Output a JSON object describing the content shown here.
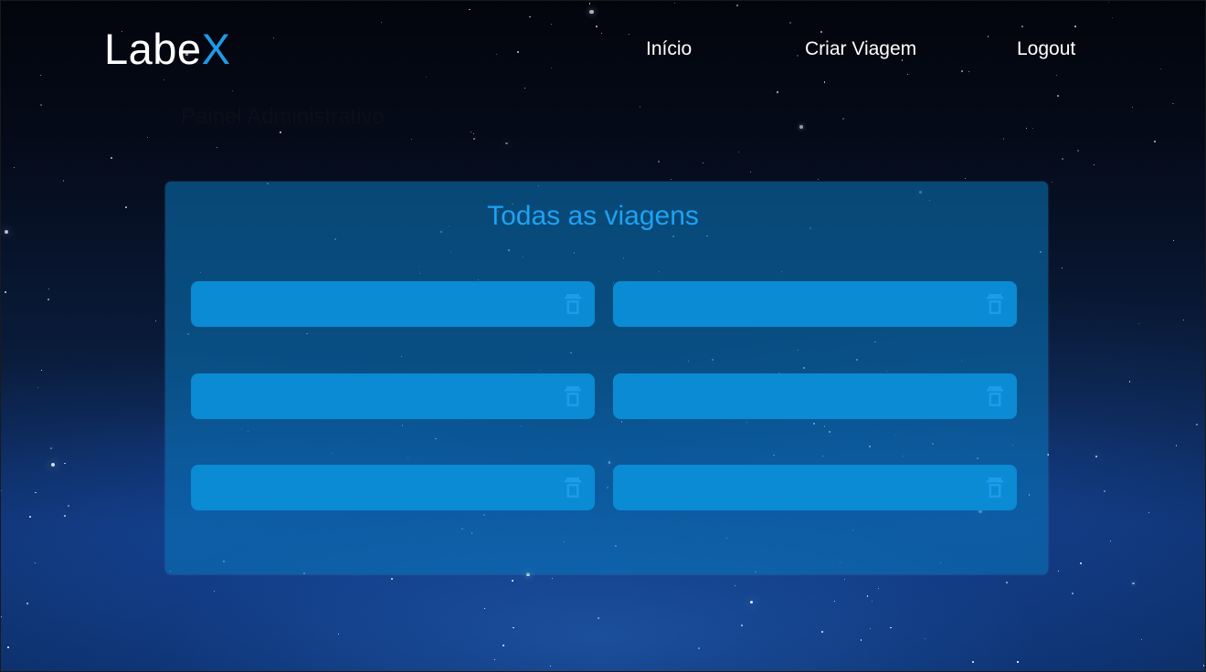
{
  "header": {
    "logo_main": "Labe",
    "logo_accent": "X",
    "nav": {
      "home": "Início",
      "create_trip": "Criar Viagem",
      "logout": "Logout"
    }
  },
  "page": {
    "title": "Painel Administrativo"
  },
  "panel": {
    "title": "Todas as viagens",
    "trips": [
      {
        "name": "",
        "delete_icon": "trash-icon"
      },
      {
        "name": "",
        "delete_icon": "trash-icon"
      },
      {
        "name": "",
        "delete_icon": "trash-icon"
      },
      {
        "name": "",
        "delete_icon": "trash-icon"
      },
      {
        "name": "",
        "delete_icon": "trash-icon"
      },
      {
        "name": "",
        "delete_icon": "trash-icon"
      }
    ]
  },
  "colors": {
    "accent": "#1e9be9",
    "card": "#0a8bd4",
    "panel": "#0a78be",
    "text_light": "#ffffff",
    "title_dark": "#0b0f19"
  }
}
